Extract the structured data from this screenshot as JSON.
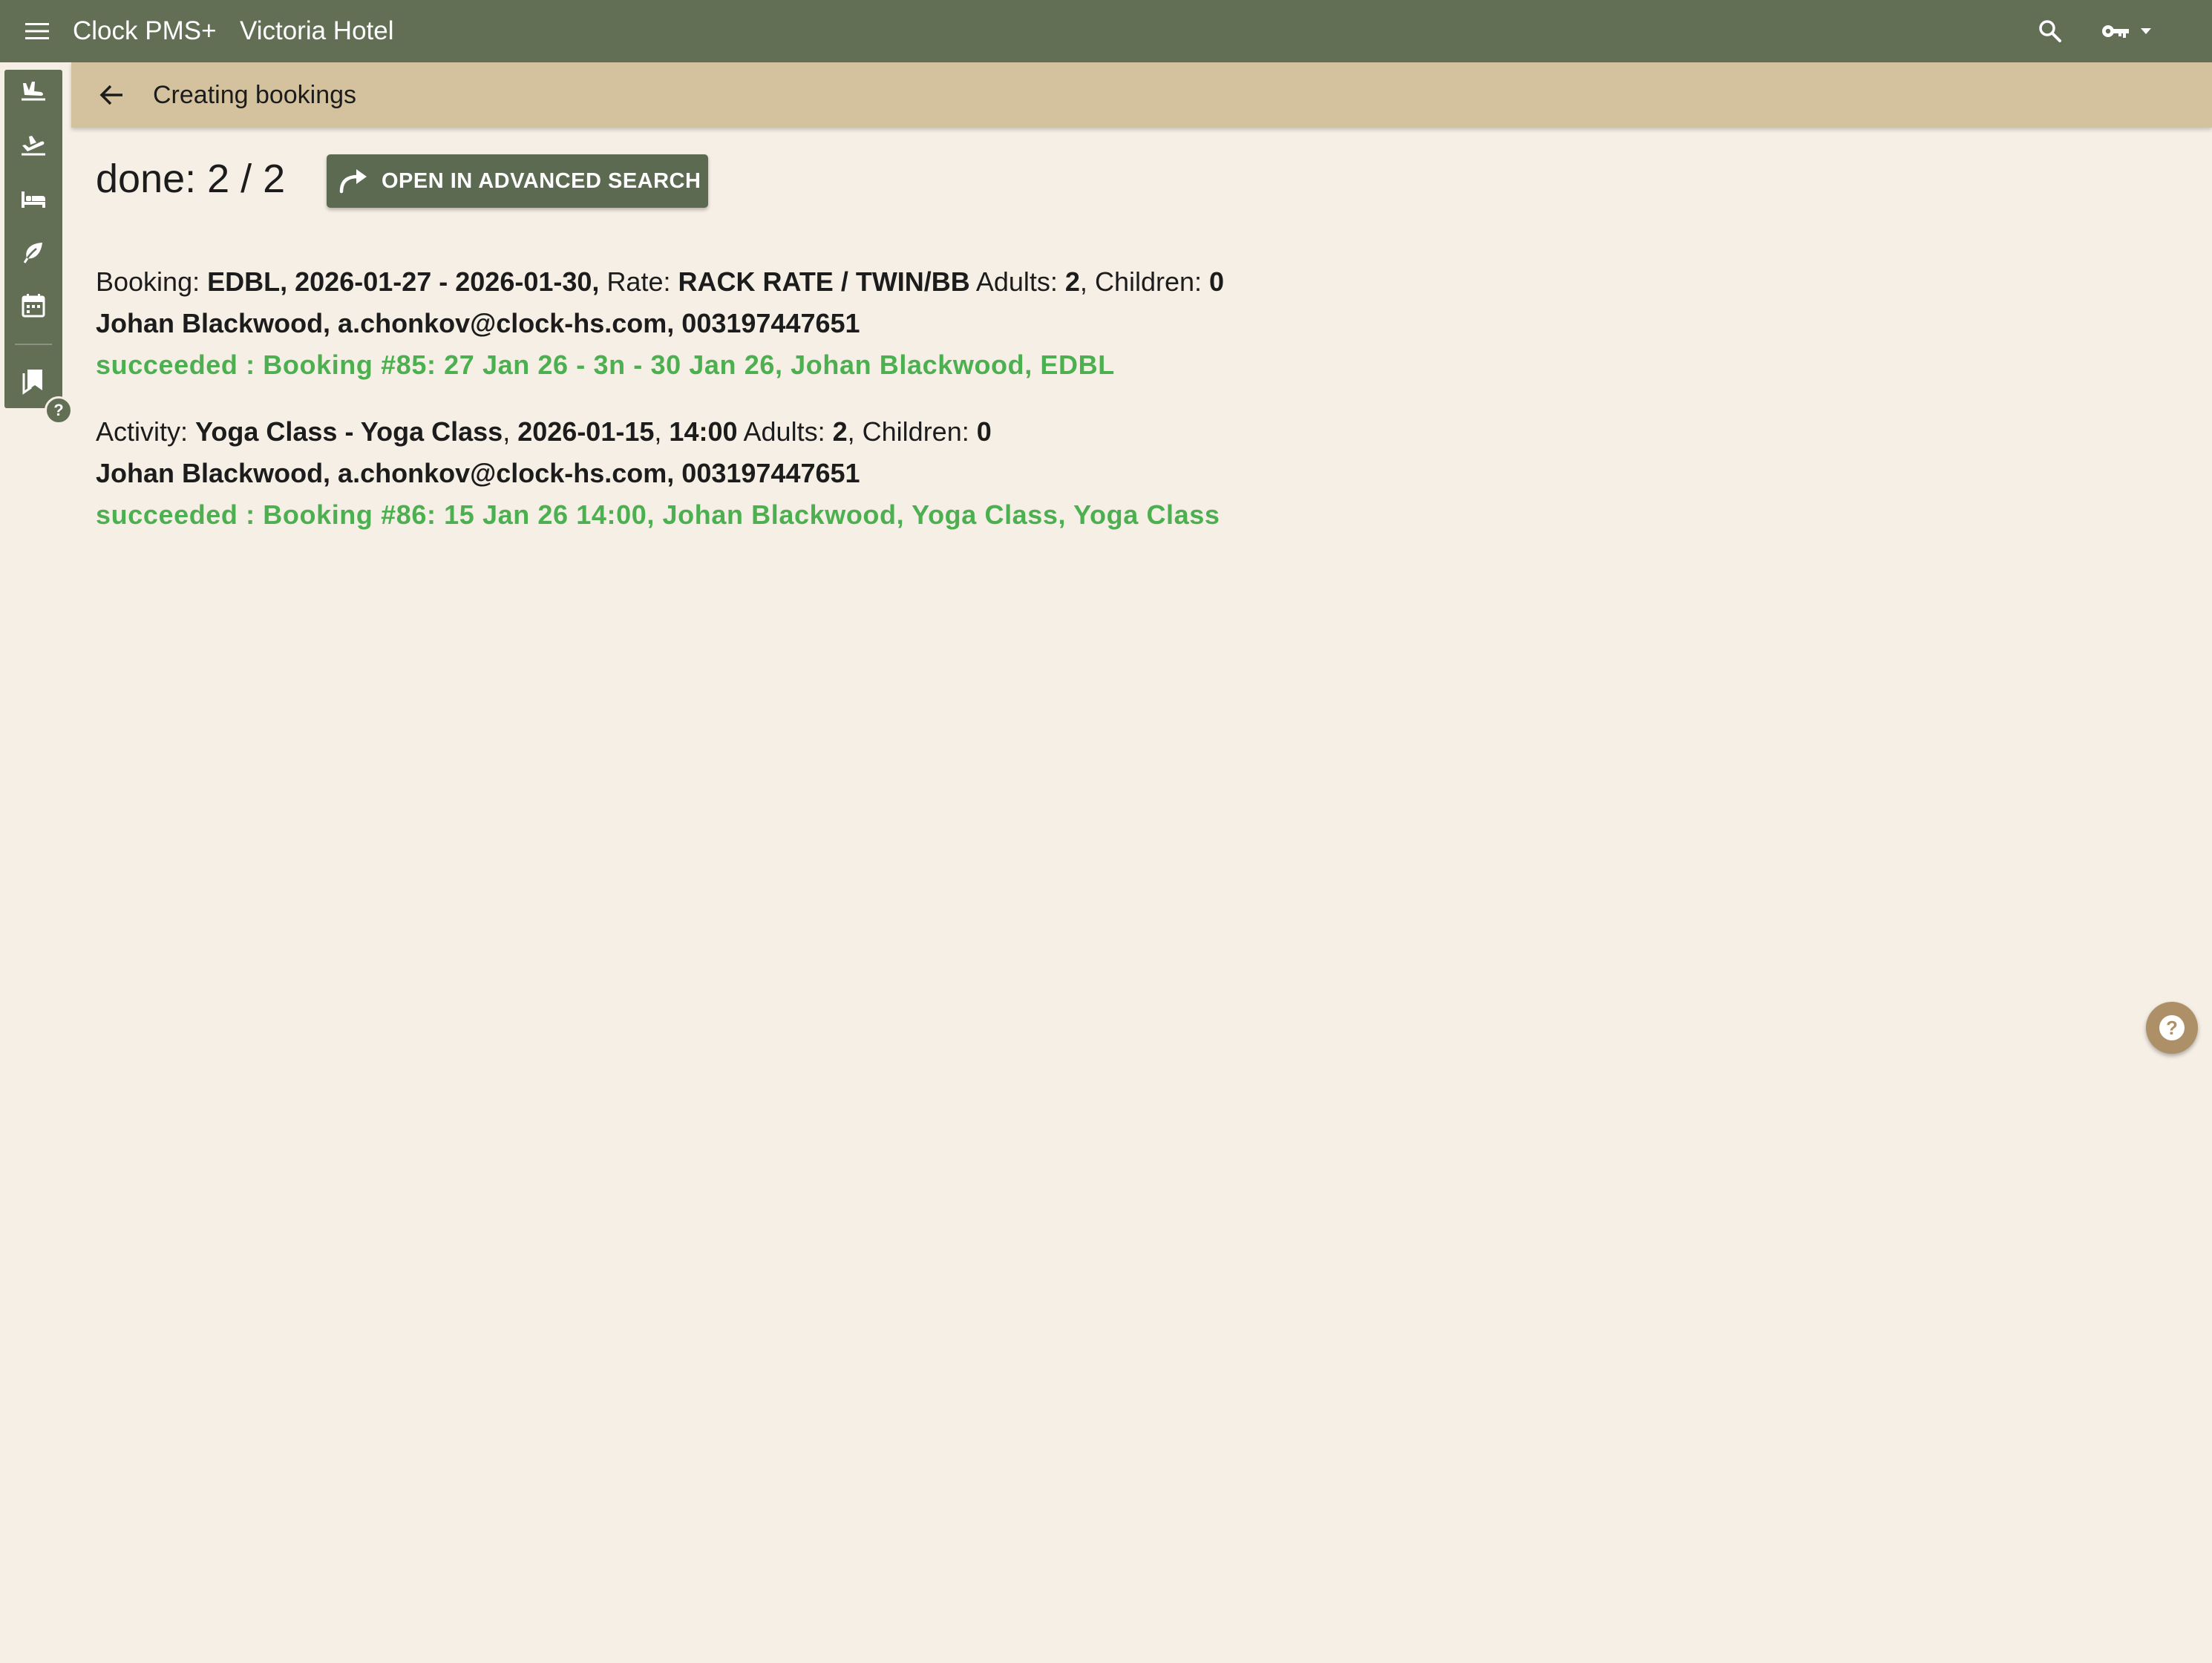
{
  "app": {
    "title": "Clock PMS+",
    "hotel": "Victoria Hotel"
  },
  "header": {
    "page_title": "Creating bookings"
  },
  "progress": {
    "text": "done: 2 / 2"
  },
  "toolbar": {
    "advanced_search_label": "OPEN IN ADVANCED SEARCH"
  },
  "rail": {
    "icons": [
      "arrivals-icon",
      "departures-icon",
      "bed-icon",
      "leaf-icon",
      "calendar-icon",
      "bookmark-icon"
    ]
  },
  "entries": [
    {
      "kind_label": "Booking:",
      "main": "EDBL, 2026-01-27 - 2026-01-30,",
      "rate_label": "Rate:",
      "rate": "RACK RATE / TWIN/BB",
      "adults_label": "Adults:",
      "adults": "2",
      "children_label": "Children:",
      "children": "0",
      "guest": "Johan Blackwood, a.chonkov@clock-hs.com, 003197447651",
      "result": "succeeded : Booking #85: 27 Jan 26 - 3n - 30 Jan 26, Johan Blackwood, EDBL"
    },
    {
      "kind_label": "Activity:",
      "name": "Yoga Class - Yoga Class",
      "date": "2026-01-15",
      "time": "14:00",
      "adults_label": "Adults:",
      "adults": "2",
      "children_label": "Children:",
      "children": "0",
      "guest": "Johan Blackwood, a.chonkov@clock-hs.com, 003197447651",
      "result": "succeeded : Booking #86: 15 Jan 26 14:00, Johan Blackwood, Yoga Class, Yoga Class"
    }
  ],
  "colors": {
    "topbar": "#636f55",
    "subbar": "#d3c29d",
    "background": "#f6efe5",
    "success": "#4caf50",
    "help_fab": "#ad9068"
  }
}
